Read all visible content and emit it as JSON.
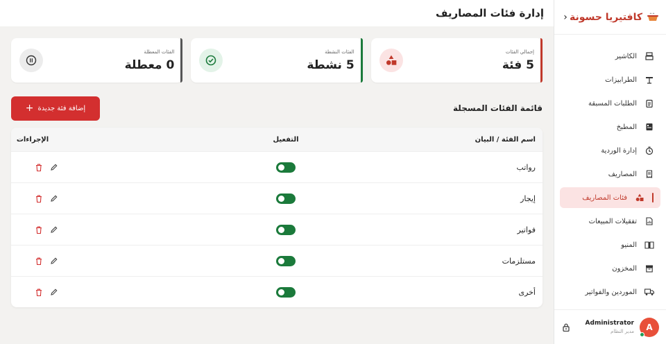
{
  "brand": {
    "name": "كافتيريا حسونة",
    "chevron": "‹"
  },
  "sidebar": {
    "items": [
      {
        "label": "الكاشير",
        "icon": "register-icon"
      },
      {
        "label": "الطرابيزات",
        "icon": "table-icon"
      },
      {
        "label": "الطلبات المسبقة",
        "icon": "clipboard-icon"
      },
      {
        "label": "المطبخ",
        "icon": "kitchen-icon"
      },
      {
        "label": "إدارة الوردية",
        "icon": "shift-icon"
      },
      {
        "label": "المصاريف",
        "icon": "receipt-icon"
      },
      {
        "label": "فئات المصاريف",
        "icon": "shapes-icon",
        "active": true
      },
      {
        "label": "تفقيلات المبيعات",
        "icon": "report-icon"
      },
      {
        "label": "المنيو",
        "icon": "book-icon"
      },
      {
        "label": "المخزون",
        "icon": "archive-icon"
      },
      {
        "label": "الموردين والفواتير",
        "icon": "truck-icon"
      }
    ]
  },
  "user": {
    "initial": "A",
    "name": "Administrator",
    "role": "مدير النظام"
  },
  "page": {
    "title": "إدارة فئات المصاريف"
  },
  "stats": [
    {
      "label": "إجمالي الفئات",
      "value": "5 فئة",
      "accent": "#c0392b",
      "circle_bg": "#fbe3e3"
    },
    {
      "label": "الفئات النشطة",
      "value": "5 نشطة",
      "accent": "#1b7a3b",
      "circle_bg": "#e3f3e8"
    },
    {
      "label": "الفئات المعطلة",
      "value": "0 معطلة",
      "accent": "#555555",
      "circle_bg": "#ececec"
    }
  ],
  "list": {
    "title": "قائمة الفئات المسجلة",
    "add_button": "إضافة فئة جديدة"
  },
  "table": {
    "headers": {
      "name": "اسم الفئة / البيان",
      "toggle": "التفعيل",
      "actions": "الإجراءات"
    },
    "rows": [
      {
        "name": "رواتب",
        "active": true
      },
      {
        "name": "إيجار",
        "active": true
      },
      {
        "name": "فواتير",
        "active": true
      },
      {
        "name": "مستلزمات",
        "active": true
      },
      {
        "name": "أخرى",
        "active": true
      }
    ]
  },
  "colors": {
    "primary": "#d32f2f",
    "toggle_on": "#1b7a3b"
  }
}
